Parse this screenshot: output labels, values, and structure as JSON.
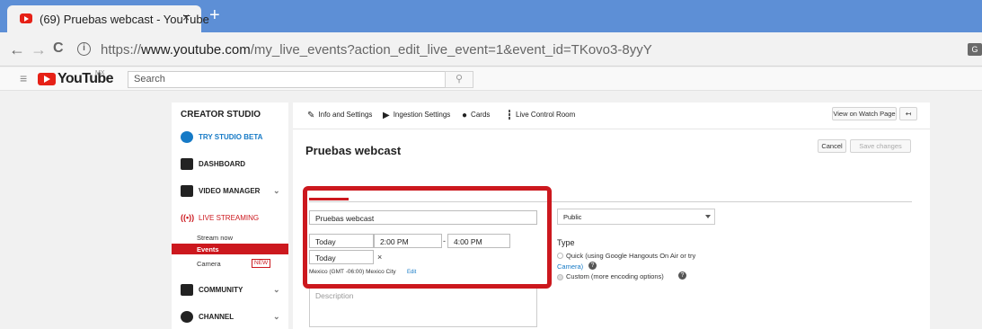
{
  "browser": {
    "tab_title": "(69) Pruebas webcast - YouTube",
    "tab_close": "×",
    "new_tab": "+",
    "back": "←",
    "forward": "→",
    "reload": "C",
    "info_icon": "i",
    "url_prefix": "https://",
    "url_host": "www.youtube.com",
    "url_path": "/my_live_events?action_edit_live_event=1&event_id=TKovo3-8yyY",
    "translate_icon": "G"
  },
  "youtube": {
    "hamburger": "≡",
    "logo_text": "YouTube",
    "region": "MX",
    "search_placeholder": "Search",
    "search_icon": "⚲"
  },
  "sidebar": {
    "heading": "CREATOR STUDIO",
    "try_beta": "TRY STUDIO BETA",
    "dashboard": "DASHBOARD",
    "video_manager": "VIDEO MANAGER",
    "live_streaming": "LIVE STREAMING",
    "stream_now": "Stream now",
    "events": "Events",
    "camera": "Camera",
    "new_badge": "NEW",
    "community": "COMMUNITY",
    "channel": "CHANNEL",
    "chevron": "⌄"
  },
  "main": {
    "tabs": {
      "info": "Info and Settings",
      "ingestion": "Ingestion Settings",
      "cards": "Cards",
      "live_control": "Live Control Room"
    },
    "view_on_watch": "View on Watch Page",
    "back_arrow": "↤",
    "title": "Pruebas webcast",
    "cancel": "Cancel",
    "save": "Save changes",
    "event_title_value": "Pruebas webcast",
    "start_date": "Today",
    "start_time": "2:00 PM",
    "dash": "-",
    "end_time": "4:00 PM",
    "end_date": "Today",
    "clear": "×",
    "timezone": "Mexico (GMT -06:00) Mexico City",
    "edit": "Edit",
    "description_placeholder": "Description",
    "privacy": "Public",
    "type_label": "Type",
    "quick_label": "Quick (using Google Hangouts On Air or try",
    "camera_link": "Camera)",
    "custom_label": "Custom (more encoding options)",
    "help": "?"
  },
  "colors": {
    "accent_red": "#cc181e",
    "chrome_blue": "#5d8fd6",
    "link_blue": "#167ac6"
  }
}
